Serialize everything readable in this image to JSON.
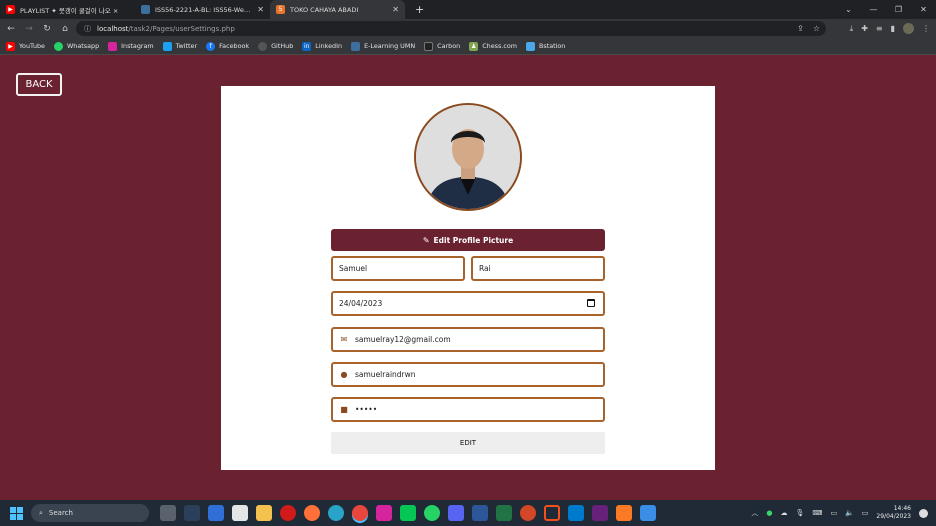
{
  "browser": {
    "tabs": [
      {
        "title": "PLAYLIST ✦ 뭇갱이 쿨걸이 나오 ×",
        "favicon_color": "#ff0000",
        "active": false
      },
      {
        "title": "ISS56-2221-A-BL: ISS56-Web De",
        "favicon_color": "#3c6e9e",
        "active": false
      },
      {
        "title": "TOKO CAHAYA ABADI",
        "favicon_color": "#e8742b",
        "active": true
      }
    ],
    "url_host": "localhost",
    "url_path": "/task2/Pages/userSettings.php",
    "bookmarks": [
      {
        "label": "YouTube",
        "icon": "youtube-icon",
        "color": "#ff0000"
      },
      {
        "label": "Whatsapp",
        "icon": "whatsapp-icon",
        "color": "#25d366"
      },
      {
        "label": "Instagram",
        "icon": "instagram-icon",
        "color": "#d6249f"
      },
      {
        "label": "Twitter",
        "icon": "twitter-icon",
        "color": "#1da1f2"
      },
      {
        "label": "Facebook",
        "icon": "facebook-icon",
        "color": "#1877f2"
      },
      {
        "label": "GitHub",
        "icon": "github-icon",
        "color": "#555555"
      },
      {
        "label": "LinkedIn",
        "icon": "linkedin-icon",
        "color": "#0a66c2"
      },
      {
        "label": "E-Learning UMN",
        "icon": "elearning-icon",
        "color": "#3c6e9e"
      },
      {
        "label": "Carbon",
        "icon": "carbon-icon",
        "color": "#222222"
      },
      {
        "label": "Chess.com",
        "icon": "chess-icon",
        "color": "#7fa650"
      },
      {
        "label": "Bstation",
        "icon": "bstation-icon",
        "color": "#4aa8e8"
      }
    ]
  },
  "page": {
    "back_label": "BACK",
    "edit_picture_label": "Edit Profile Picture",
    "first_name": "Samuel",
    "last_name": "Rai",
    "birth_date": "24/04/2023",
    "email": "samuelray12@gmail.com",
    "username": "samuelraindrwn",
    "password_mask": "•••••",
    "edit_label": "EDIT"
  },
  "colors": {
    "background": "#6a2130",
    "accent": "#6a2130",
    "field_border": "#a8632a"
  },
  "taskbar": {
    "search_label": "Search",
    "time": "14:46",
    "date": "29/04/2023"
  }
}
